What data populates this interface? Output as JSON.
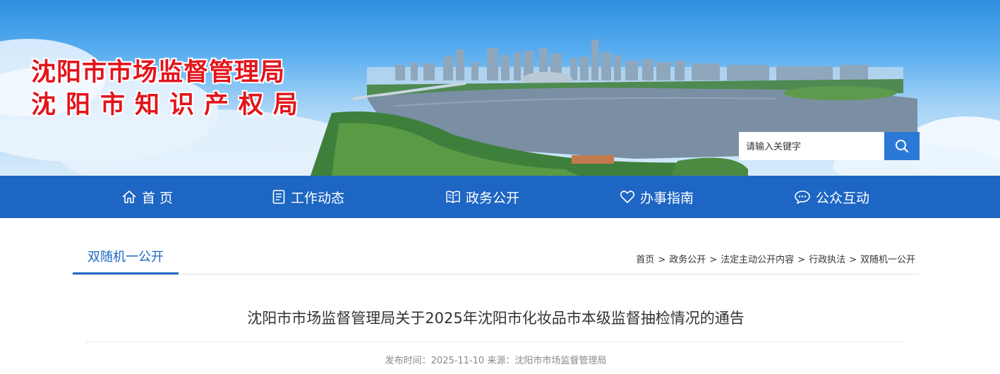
{
  "header": {
    "org_name_line1": "沈阳市市场监督管理局",
    "org_name_line2": "沈阳市知识产权局",
    "search": {
      "placeholder": "请输入关键字",
      "button_icon": "search-icon"
    }
  },
  "nav": {
    "items": [
      {
        "label": "首 页",
        "icon": "home-icon"
      },
      {
        "label": "工作动态",
        "icon": "document-icon"
      },
      {
        "label": "政务公开",
        "icon": "book-icon"
      },
      {
        "label": "办事指南",
        "icon": "heart-icon"
      },
      {
        "label": "公众互动",
        "icon": "chat-icon"
      }
    ]
  },
  "section": {
    "title": "双随机一公开",
    "breadcrumb": [
      "首页",
      "政务公开",
      "法定主动公开内容",
      "行政执法",
      "双随机一公开"
    ],
    "breadcrumb_separator": ">"
  },
  "article": {
    "title": "沈阳市市场监督管理局关于2025年沈阳市化妆品市本级监督抽检情况的通告",
    "meta": "发布时间：2025-11-10 来源：沈阳市市场监督管理局"
  },
  "colors": {
    "nav_bg": "#1e66c3",
    "accent": "#1e66c3",
    "logo_red": "#e3141b",
    "search_button": "#2b79d6"
  }
}
